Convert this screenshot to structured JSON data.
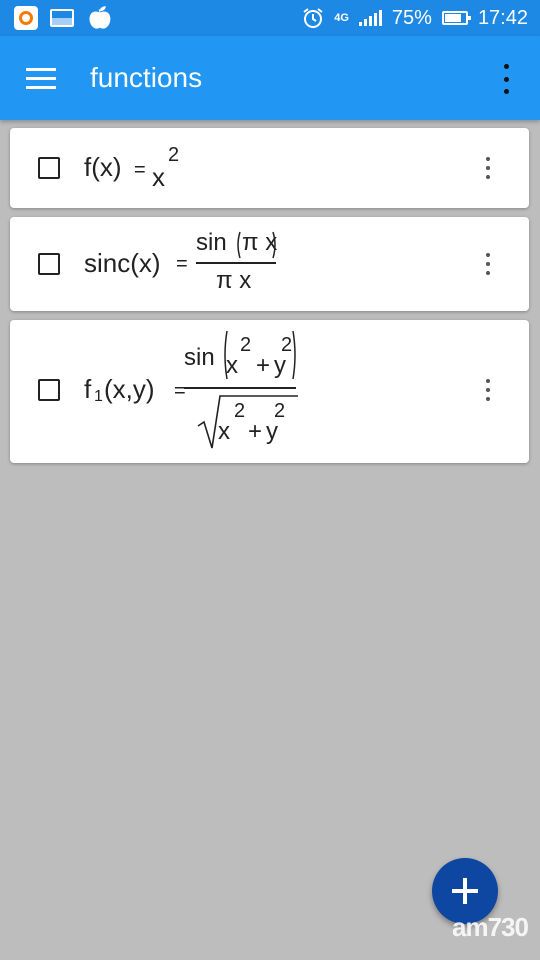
{
  "status_bar": {
    "network": "4G",
    "battery_text": "75%",
    "battery_level": 0.75,
    "time": "17:42",
    "icons": [
      "app-notification-icon",
      "image-notification-icon",
      "apple-notification-icon",
      "alarm-icon",
      "signal-icon",
      "battery-icon"
    ]
  },
  "app_bar": {
    "title": "functions",
    "menu_icon": "hamburger-menu-icon",
    "overflow_icon": "more-vert-icon"
  },
  "functions": [
    {
      "lhs": "f(x)",
      "eq": "=",
      "base": "x",
      "exponent": "2"
    },
    {
      "lhs": "sinc(x)",
      "eq": "=",
      "num_fn": "sin",
      "num_arg": "π x",
      "den": "π x"
    },
    {
      "lhs_name": "f",
      "lhs_sub": "1",
      "lhs_args": "(x,y)",
      "eq": "=",
      "num_fn": "sin",
      "x": "x",
      "y": "y",
      "exp": "2",
      "plus": "+"
    }
  ],
  "fab": {
    "icon": "add-icon"
  },
  "watermark": "am730",
  "colors": {
    "status_bar": "#1e88e5",
    "app_bar": "#2196f3",
    "background": "#bdbdbd",
    "fab": "#0d47a1"
  }
}
